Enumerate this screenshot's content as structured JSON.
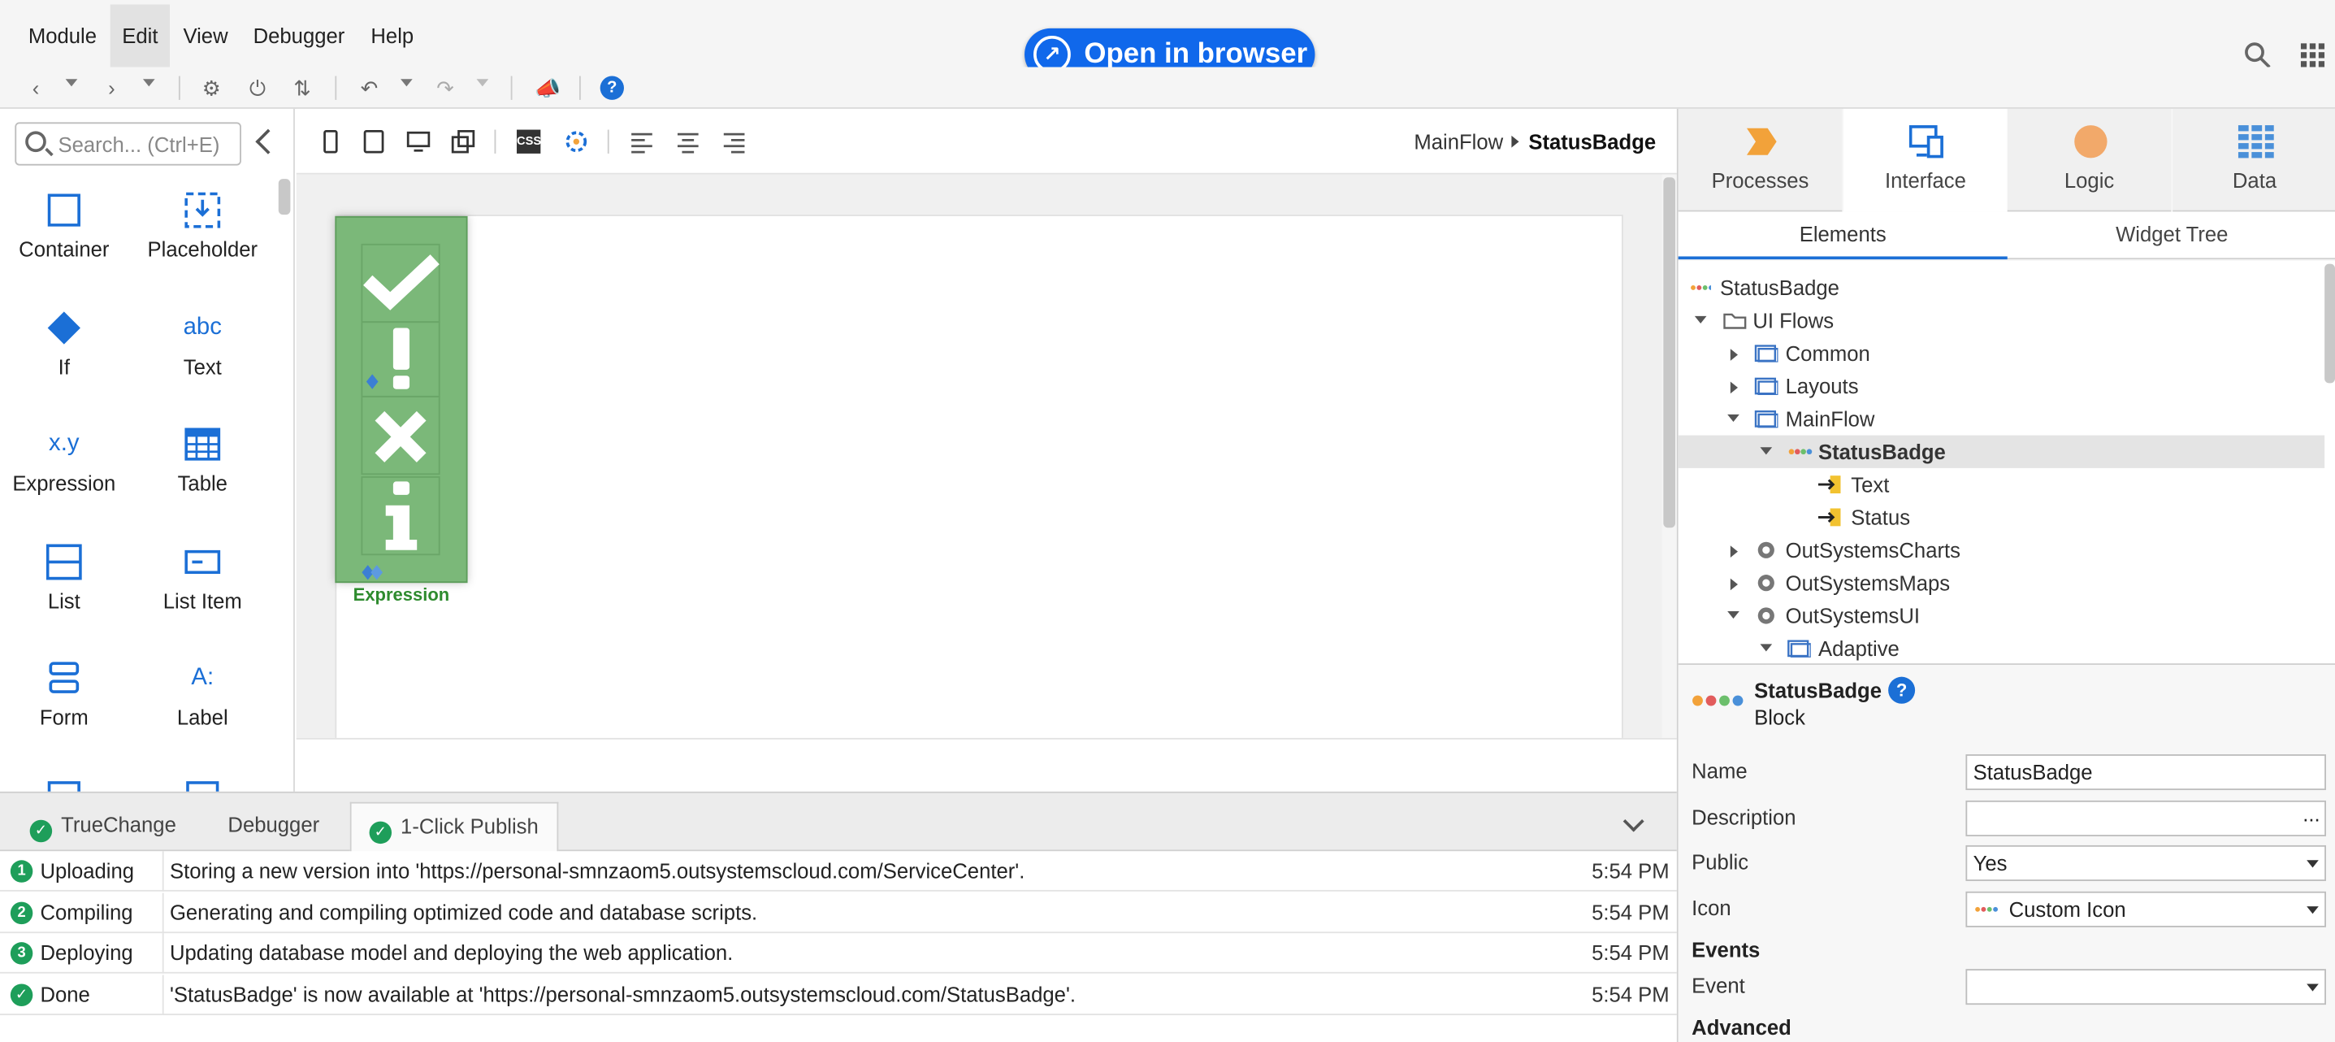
{
  "menu": {
    "items": [
      "Module",
      "Edit",
      "View",
      "Debugger",
      "Help"
    ]
  },
  "open_in_browser": {
    "label": "Open in browser"
  },
  "toolbox": {
    "search_placeholder": "Search... (Ctrl+E)",
    "tools": [
      {
        "label": "Container",
        "icon": "container-icon"
      },
      {
        "label": "Placeholder",
        "icon": "placeholder-icon"
      },
      {
        "label": "If",
        "icon": "if-icon"
      },
      {
        "label": "Text",
        "icon": "text-icon",
        "glyph": "abc"
      },
      {
        "label": "Expression",
        "icon": "expression-icon",
        "glyph": "x.y"
      },
      {
        "label": "Table",
        "icon": "table-icon"
      },
      {
        "label": "List",
        "icon": "list-icon"
      },
      {
        "label": "List Item",
        "icon": "list-item-icon"
      },
      {
        "label": "Form",
        "icon": "form-icon"
      },
      {
        "label": "Label",
        "icon": "label-icon",
        "glyph": "A:"
      }
    ]
  },
  "canvas": {
    "breadcrumb_parent": "MainFlow",
    "breadcrumb_current": "StatusBadge",
    "badge_label": "Expression"
  },
  "bottom": {
    "tabs": [
      {
        "label": "TrueChange",
        "status": "ok"
      },
      {
        "label": "Debugger"
      },
      {
        "label": "1-Click Publish",
        "status": "ok"
      }
    ],
    "log": [
      {
        "step": "1",
        "stage": "Uploading",
        "message": "Storing a new version into 'https://personal-smnzaom5.outsystemscloud.com/ServiceCenter'.",
        "time": "5:54 PM"
      },
      {
        "step": "2",
        "stage": "Compiling",
        "message": "Generating and compiling optimized code and database scripts.",
        "time": "5:54 PM"
      },
      {
        "step": "3",
        "stage": "Deploying",
        "message": "Updating database model and deploying the web application.",
        "time": "5:54 PM"
      },
      {
        "step": "✓",
        "stage": "Done",
        "message": "'StatusBadge' is now available at 'https://personal-smnzaom5.outsystemscloud.com/StatusBadge'.",
        "time": "5:54 PM"
      }
    ]
  },
  "right": {
    "category_tabs": [
      {
        "label": "Processes",
        "icon": "processes-icon"
      },
      {
        "label": "Interface",
        "icon": "interface-icon"
      },
      {
        "label": "Logic",
        "icon": "logic-icon"
      },
      {
        "label": "Data",
        "icon": "data-icon"
      }
    ],
    "sub_tabs": [
      "Elements",
      "Widget Tree"
    ],
    "tree": [
      {
        "label": "StatusBadge",
        "depth": 0,
        "icon": "module-dots-icon"
      },
      {
        "label": "UI Flows",
        "depth": 0,
        "icon": "folder-icon",
        "state": "open"
      },
      {
        "label": "Common",
        "depth": 1,
        "icon": "flow-icon",
        "state": "closed"
      },
      {
        "label": "Layouts",
        "depth": 1,
        "icon": "flow-icon",
        "state": "closed"
      },
      {
        "label": "MainFlow",
        "depth": 1,
        "icon": "flow-icon",
        "state": "open"
      },
      {
        "label": "StatusBadge",
        "depth": 2,
        "icon": "block-dots-icon",
        "state": "open",
        "selected": true
      },
      {
        "label": "Text",
        "depth": 3,
        "icon": "input-param-icon"
      },
      {
        "label": "Status",
        "depth": 3,
        "icon": "input-param-icon"
      },
      {
        "label": "OutSystemsCharts",
        "depth": 1,
        "icon": "reference-icon",
        "state": "closed"
      },
      {
        "label": "OutSystemsMaps",
        "depth": 1,
        "icon": "reference-icon",
        "state": "closed"
      },
      {
        "label": "OutSystemsUI",
        "depth": 1,
        "icon": "reference-icon",
        "state": "open"
      },
      {
        "label": "Adaptive",
        "depth": 2,
        "icon": "flow-icon",
        "state": "open"
      }
    ],
    "properties": {
      "title": "StatusBadge",
      "subtitle": "Block",
      "rows": [
        {
          "label": "Name",
          "value": "StatusBadge"
        },
        {
          "label": "Description",
          "value": "",
          "trailing": "..."
        },
        {
          "label": "Public",
          "value": "Yes",
          "dropdown": true
        },
        {
          "label": "Icon",
          "value": "Custom Icon",
          "dropdown": true
        }
      ],
      "events_header": "Events",
      "event_row": {
        "label": "Event",
        "value": "",
        "dropdown": true
      },
      "advanced_header": "Advanced"
    }
  },
  "colors": {
    "accent": "#1b6fd6",
    "publish_button": "#1068eb",
    "success": "#1e9e5a",
    "badge_green": "#7bb879"
  }
}
